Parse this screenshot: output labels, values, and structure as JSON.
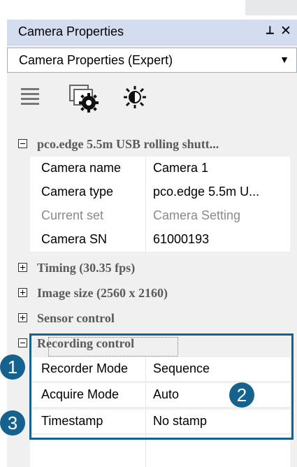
{
  "panel": {
    "title": "Camera Properties",
    "pin_icon": "pin-icon",
    "close_icon": "close-icon",
    "combo_value": "Camera Properties (Expert)"
  },
  "toolbar": {
    "icons": [
      "list-icon",
      "camera-settings-icon",
      "brightness-icon"
    ]
  },
  "camera_group": {
    "title": "pco.edge 5.5m USB rolling shutt...",
    "rows": [
      {
        "key": "Camera name",
        "value": "Camera 1"
      },
      {
        "key": "Camera type",
        "value": "pco.edge 5.5m U..."
      },
      {
        "key": "Current set",
        "value": "Camera Setting"
      },
      {
        "key": "Camera SN",
        "value": "61000193"
      }
    ]
  },
  "groups": {
    "timing": "Timing (30.35 fps)",
    "image_size": "Image size (2560 x 2160)",
    "sensor": "Sensor control",
    "recording": "Recording control"
  },
  "recording_rows": [
    {
      "key": "Recorder Mode",
      "value": "Sequence"
    },
    {
      "key": "Acquire Mode",
      "value": "Auto"
    },
    {
      "key": "Timestamp",
      "value": "No stamp"
    }
  ],
  "badges": [
    "1",
    "2",
    "3"
  ],
  "colors": {
    "highlight": "#15628f",
    "titlebar": "#d4ddef"
  }
}
